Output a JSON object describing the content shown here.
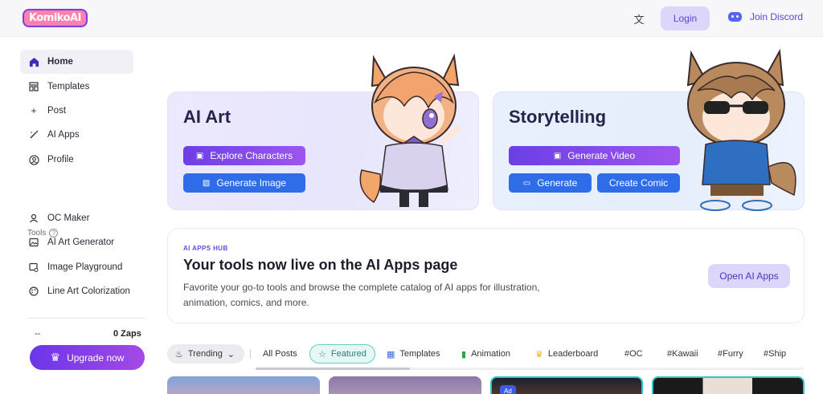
{
  "header": {
    "logo_text": "KomikoAI",
    "login_label": "Login",
    "discord_label": "Join Discord"
  },
  "sidebar": {
    "items": [
      {
        "label": "Home",
        "icon": "home-icon"
      },
      {
        "label": "Templates",
        "icon": "templates-icon"
      },
      {
        "label": "Post",
        "icon": "plus-icon"
      },
      {
        "label": "AI Apps",
        "icon": "magic-wand-icon"
      },
      {
        "label": "Profile",
        "icon": "profile-icon"
      }
    ],
    "tools_label": "Tools",
    "tools": [
      {
        "label": "OC Maker",
        "icon": "user-icon"
      },
      {
        "label": "AI Art Generator",
        "icon": "image-icon"
      },
      {
        "label": "Image Playground",
        "icon": "image-edit-icon"
      },
      {
        "label": "Line Art Colorization",
        "icon": "palette-icon"
      }
    ],
    "zaps_left": "--",
    "zaps_right": "0 Zaps",
    "upgrade_label": "Upgrade now"
  },
  "cards": {
    "art": {
      "title": "AI Art",
      "explore_label": "Explore Characters",
      "generate_image_label": "Generate Image"
    },
    "story": {
      "title": "Storytelling",
      "generate_video_label": "Generate Video",
      "generate_label": "Generate",
      "create_comic_label": "Create Comic"
    }
  },
  "hub": {
    "tag": "AI APPS HUB",
    "title": "Your tools now live on the AI Apps page",
    "description": "Favorite your go-to tools and browse the complete catalog of AI apps for illustration, animation, comics, and more.",
    "button_label": "Open AI Apps"
  },
  "filters": {
    "trending_label": "Trending",
    "chips": [
      "All Posts",
      "Featured",
      "Templates",
      "Animation",
      "Leaderboard",
      "#OC",
      "#Kawaii",
      "#Furry",
      "#Ship"
    ]
  },
  "feed": {
    "ad_label": "Ad"
  },
  "colors": {
    "accent": "#6b36e8",
    "blue": "#2f6ce8",
    "featured_border": "#63cfc4"
  }
}
